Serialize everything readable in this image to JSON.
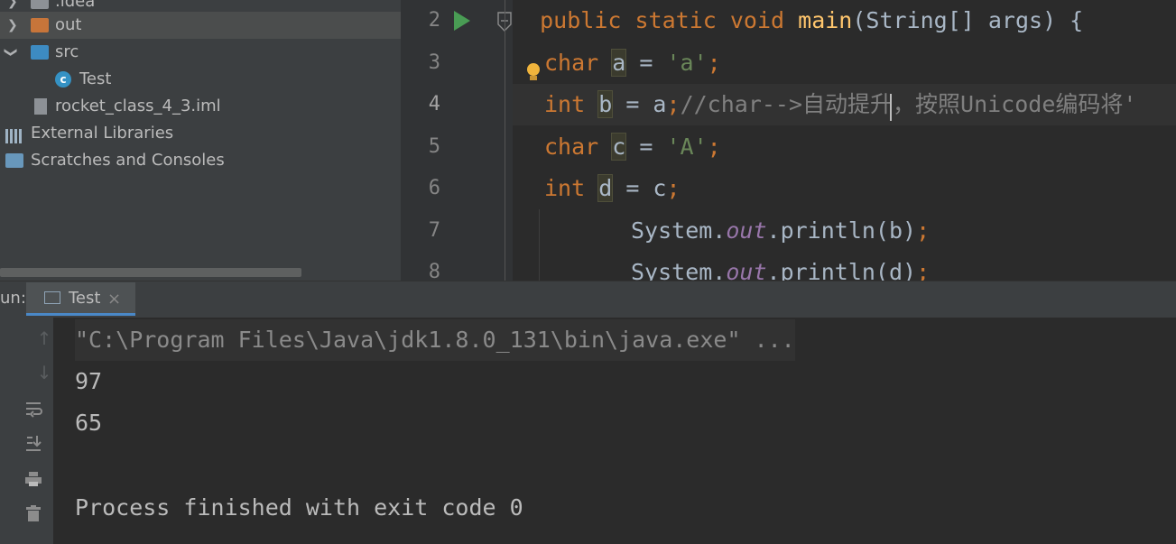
{
  "project_tree": {
    "items": [
      {
        "label": ".idea",
        "kind": "folder"
      },
      {
        "label": "out",
        "kind": "folder-orange"
      },
      {
        "label": "src",
        "kind": "folder-blue"
      },
      {
        "label": "Test",
        "kind": "class"
      },
      {
        "label": "rocket_class_4_3.iml",
        "kind": "file"
      },
      {
        "label": "External Libraries",
        "kind": "libraries"
      },
      {
        "label": "Scratches and Consoles",
        "kind": "scratches"
      }
    ]
  },
  "editor": {
    "line_numbers": [
      "2",
      "3",
      "4",
      "5",
      "6",
      "7",
      "8"
    ],
    "current_line": "4",
    "lines": {
      "l2": {
        "indent": "  ",
        "kw1": "public",
        "kw2": "static",
        "kw3": "void",
        "fn": "main",
        "rest": "(String[] args) {"
      },
      "l3": {
        "kw": "char",
        "var": "a",
        "eq": " = ",
        "str": "'a'",
        "semi": ";"
      },
      "l4": {
        "kw": "int",
        "var": "b",
        "mid": " = a",
        "semi": ";",
        "comment": "//char-->自动提升，按照Unicode编码将'"
      },
      "l5": {
        "kw": "char",
        "var": "c",
        "eq": " = ",
        "str": "'A'",
        "semi": ";"
      },
      "l6": {
        "kw": "int",
        "var": "d",
        "mid": " = c",
        "semi": ";"
      },
      "l7": {
        "indent": "    ",
        "obj": "System.",
        "field": "out",
        "call": ".println(b)",
        "semi": ";"
      },
      "l8": {
        "indent": "    ",
        "obj": "System.",
        "field": "out",
        "call": ".println(d)",
        "semi": ";"
      }
    }
  },
  "run_panel": {
    "label": "un:",
    "tab_label": "Test",
    "tab_close": "×",
    "console_lines": [
      "\"C:\\Program Files\\Java\\jdk1.8.0_131\\bin\\java.exe\" ...",
      "97",
      "65",
      "",
      "Process finished with exit code 0"
    ]
  },
  "icons": {
    "tree_expand": "chevron-right-icon",
    "tree_collapse": "chevron-down-icon",
    "run": "run-gutter-icon",
    "intention": "lightbulb-icon"
  },
  "colors": {
    "keyword": "#cc7832",
    "function": "#ffc66d",
    "string": "#6a8759",
    "comment": "#808080",
    "static_field": "#9876aa",
    "run_green": "#499c54"
  }
}
